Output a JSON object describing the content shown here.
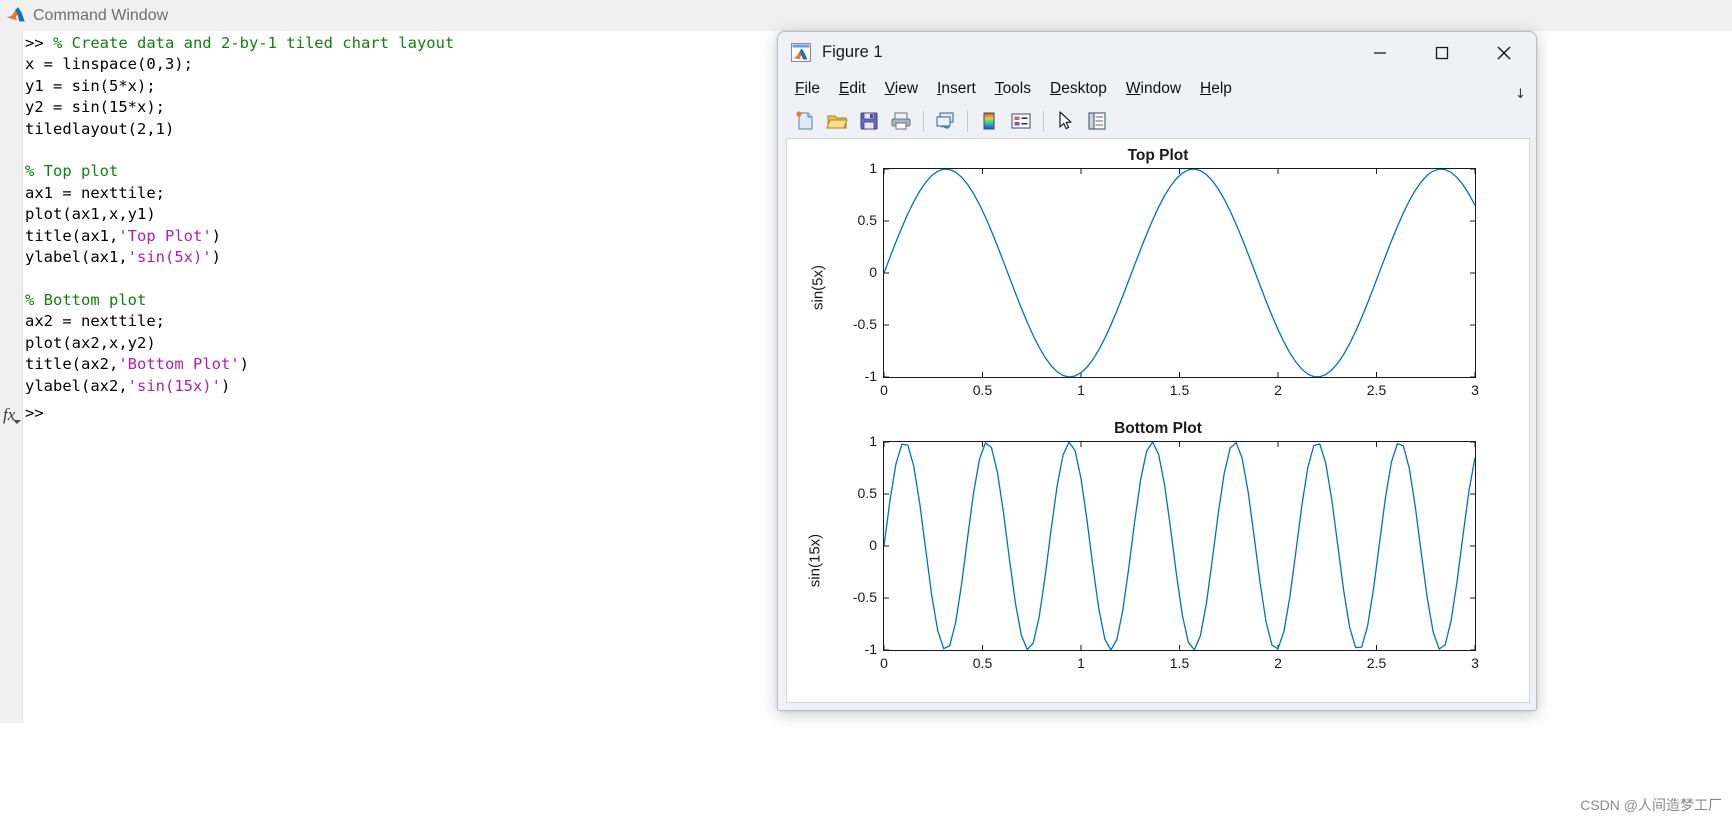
{
  "command_window": {
    "title": "Command Window",
    "icon": "matlab-logo-icon",
    "lines": [
      [
        {
          "t": "plain",
          "s": ">> "
        },
        {
          "t": "comment",
          "s": "% Create data and 2-by-1 tiled chart layout"
        }
      ],
      [
        {
          "t": "plain",
          "s": "x = linspace(0,3);"
        }
      ],
      [
        {
          "t": "plain",
          "s": "y1 = sin(5*x);"
        }
      ],
      [
        {
          "t": "plain",
          "s": "y2 = sin(15*x);"
        }
      ],
      [
        {
          "t": "plain",
          "s": "tiledlayout(2,1)"
        }
      ],
      [
        {
          "t": "plain",
          "s": ""
        }
      ],
      [
        {
          "t": "comment",
          "s": "% Top plot"
        }
      ],
      [
        {
          "t": "plain",
          "s": "ax1 = nexttile;"
        }
      ],
      [
        {
          "t": "plain",
          "s": "plot(ax1,x,y1)"
        }
      ],
      [
        {
          "t": "plain",
          "s": "title(ax1,"
        },
        {
          "t": "string",
          "s": "'Top Plot'"
        },
        {
          "t": "plain",
          "s": ")"
        }
      ],
      [
        {
          "t": "plain",
          "s": "ylabel(ax1,"
        },
        {
          "t": "string",
          "s": "'sin(5x)'"
        },
        {
          "t": "plain",
          "s": ")"
        }
      ],
      [
        {
          "t": "plain",
          "s": ""
        }
      ],
      [
        {
          "t": "comment",
          "s": "% Bottom plot"
        }
      ],
      [
        {
          "t": "plain",
          "s": "ax2 = nexttile;"
        }
      ],
      [
        {
          "t": "plain",
          "s": "plot(ax2,x,y2)"
        }
      ],
      [
        {
          "t": "plain",
          "s": "title(ax2,"
        },
        {
          "t": "string",
          "s": "'Bottom Plot'"
        },
        {
          "t": "plain",
          "s": ")"
        }
      ],
      [
        {
          "t": "plain",
          "s": "ylabel(ax2,"
        },
        {
          "t": "string",
          "s": "'sin(15x)'"
        },
        {
          "t": "plain",
          "s": ")"
        }
      ]
    ],
    "prompt": ">>",
    "fx_label": "fx",
    "colors": {
      "comment": "#108010",
      "string": "#b020b0",
      "plain": "#000000",
      "titlebar_bg": "#f0f0f0",
      "title_text": "#6e6e6e"
    }
  },
  "figure_window": {
    "title": "Figure 1",
    "icon": "matlab-figure-icon",
    "window_buttons": [
      {
        "name": "minimize-button",
        "glyph": "─"
      },
      {
        "name": "maximize-button",
        "glyph": "□"
      },
      {
        "name": "close-button",
        "glyph": "✕"
      }
    ],
    "menus": [
      {
        "mnemonic": "F",
        "rest": "ile"
      },
      {
        "mnemonic": "E",
        "rest": "dit"
      },
      {
        "mnemonic": "V",
        "rest": "iew"
      },
      {
        "mnemonic": "I",
        "rest": "nsert"
      },
      {
        "mnemonic": "T",
        "rest": "ools"
      },
      {
        "mnemonic": "D",
        "rest": "esktop"
      },
      {
        "mnemonic": "W",
        "rest": "indow"
      },
      {
        "mnemonic": "H",
        "rest": "elp"
      }
    ],
    "menu_overflow_glyph": "↘",
    "toolbar": [
      {
        "name": "new-figure-icon",
        "tip": "New Figure"
      },
      {
        "name": "open-file-icon",
        "tip": "Open File"
      },
      {
        "name": "save-figure-icon",
        "tip": "Save Figure"
      },
      {
        "name": "print-figure-icon",
        "tip": "Print Figure"
      },
      {
        "sep": true
      },
      {
        "name": "link-plot-icon",
        "tip": "Link Plot"
      },
      {
        "sep": true
      },
      {
        "name": "colorbar-icon",
        "tip": "Insert Colorbar"
      },
      {
        "name": "legend-icon",
        "tip": "Insert Legend"
      },
      {
        "sep": true
      },
      {
        "name": "pointer-arrow-icon",
        "tip": "Edit Plot"
      },
      {
        "name": "property-inspector-icon",
        "tip": "Open Property Inspector"
      }
    ]
  },
  "chart_data": [
    {
      "type": "line",
      "title": "Top Plot",
      "xlabel": "",
      "ylabel": "sin(5x)",
      "expression": "sin(5*x)",
      "xlim": [
        0,
        3
      ],
      "ylim": [
        -1,
        1
      ],
      "xticks": [
        "0",
        "0.5",
        "1",
        "1.5",
        "2",
        "2.5",
        "3"
      ],
      "xtick_values": [
        0,
        0.5,
        1,
        1.5,
        2,
        2.5,
        3
      ],
      "yticks": [
        "1",
        "0.5",
        "0",
        "-0.5",
        "-1"
      ],
      "ytick_values": [
        1,
        0.5,
        0,
        -0.5,
        -1
      ],
      "grid": false,
      "legend": null,
      "line_color": "#0072BD",
      "frequency": 5,
      "n_points": 100
    },
    {
      "type": "line",
      "title": "Bottom Plot",
      "xlabel": "",
      "ylabel": "sin(15x)",
      "expression": "sin(15*x)",
      "xlim": [
        0,
        3
      ],
      "ylim": [
        -1,
        1
      ],
      "xticks": [
        "0",
        "0.5",
        "1",
        "1.5",
        "2",
        "2.5",
        "3"
      ],
      "xtick_values": [
        0,
        0.5,
        1,
        1.5,
        2,
        2.5,
        3
      ],
      "yticks": [
        "1",
        "0.5",
        "0",
        "-0.5",
        "-1"
      ],
      "ytick_values": [
        1,
        0.5,
        0,
        -0.5,
        -1
      ],
      "grid": false,
      "legend": null,
      "line_color": "#0072BD",
      "frequency": 15,
      "n_points": 100
    }
  ],
  "watermark": "CSDN @人间造梦工厂"
}
